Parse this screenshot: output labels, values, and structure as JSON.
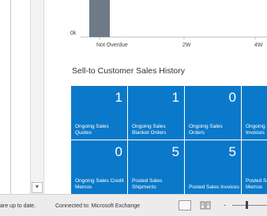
{
  "chart_data": {
    "type": "bar",
    "categories": [
      "Not Overdue",
      "2W",
      "4W"
    ],
    "values": [
      2,
      0,
      0
    ],
    "y_ticks": [
      "0k"
    ],
    "bar_color": "#6f7a88"
  },
  "cues": {
    "title": "Sell-to Customer Sales History",
    "tile_color": "#0b79c9",
    "tiles": [
      {
        "count": "1",
        "label": "Ongoing Sales Quotes"
      },
      {
        "count": "1",
        "label": "Ongoing Sales Blanket Orders"
      },
      {
        "count": "0",
        "label": "Ongoing Sales Orders"
      },
      {
        "count": "",
        "label": "Ongoing Sales Invoices"
      },
      {
        "count": "0",
        "label": "Ongoing Sales Credit Memos"
      },
      {
        "count": "5",
        "label": "Posted Sales Shipments"
      },
      {
        "count": "5",
        "label": "Posted Sales Invoices"
      },
      {
        "count": "",
        "label": "Posted Sales Credit Memos"
      }
    ]
  },
  "status_bar": {
    "sync_text": "are up to date.",
    "connection_text": "Connected to: Microsoft Exchange",
    "zoom_minus": "-"
  },
  "icons": {
    "scroll_down": "scroll-down-arrow-icon",
    "normal_view": "normal-view-icon",
    "reading_view": "reading-view-icon"
  }
}
